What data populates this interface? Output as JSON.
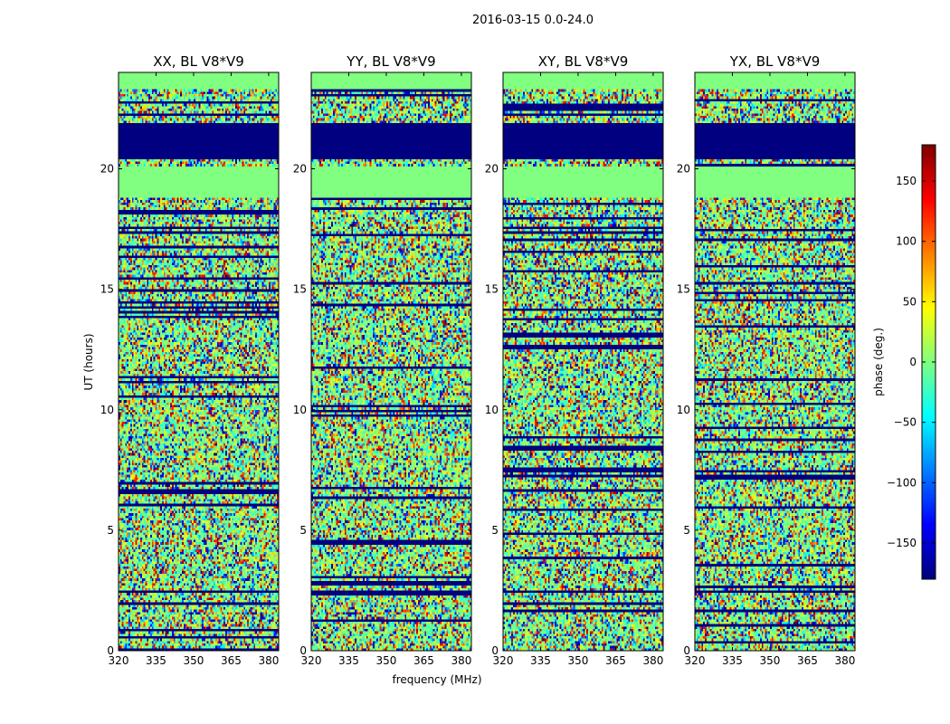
{
  "figure": {
    "suptitle": "2016-03-15 0.0-24.0"
  },
  "chart_data": {
    "type": "heatmap",
    "title": "2016-03-15 0.0-24.0",
    "xlabel": "frequency (MHz)",
    "ylabel": "UT (hours)",
    "colorbar_label": "phase (deg.)",
    "xlim": [
      320,
      384
    ],
    "ylim": [
      0,
      24
    ],
    "clim": [
      -180,
      180
    ],
    "xticks": [
      320,
      335,
      350,
      365,
      380
    ],
    "yticks": [
      0,
      5,
      10,
      15,
      20
    ],
    "cticks": [
      150,
      100,
      50,
      0,
      -50,
      -100,
      -150
    ],
    "colormap": "jet",
    "panels": [
      {
        "title": "XX, BL V8*V9",
        "pol": "XX"
      },
      {
        "title": "YY, BL V8*V9",
        "pol": "YY"
      },
      {
        "title": "XY, BL V8*V9",
        "pol": "XY"
      },
      {
        "title": "YX, BL V8*V9",
        "pol": "YX"
      }
    ],
    "masked_phase_value": 0,
    "flagged_phase_value": -180,
    "masked_time_ranges_hours": [
      [
        23.3,
        24.0
      ],
      [
        18.8,
        20.1
      ]
    ],
    "flagged_time_ranges_hours": [
      [
        20.4,
        21.9
      ]
    ]
  },
  "colors": {
    "masked": "#7dff7a",
    "flagged": "#00008f"
  }
}
